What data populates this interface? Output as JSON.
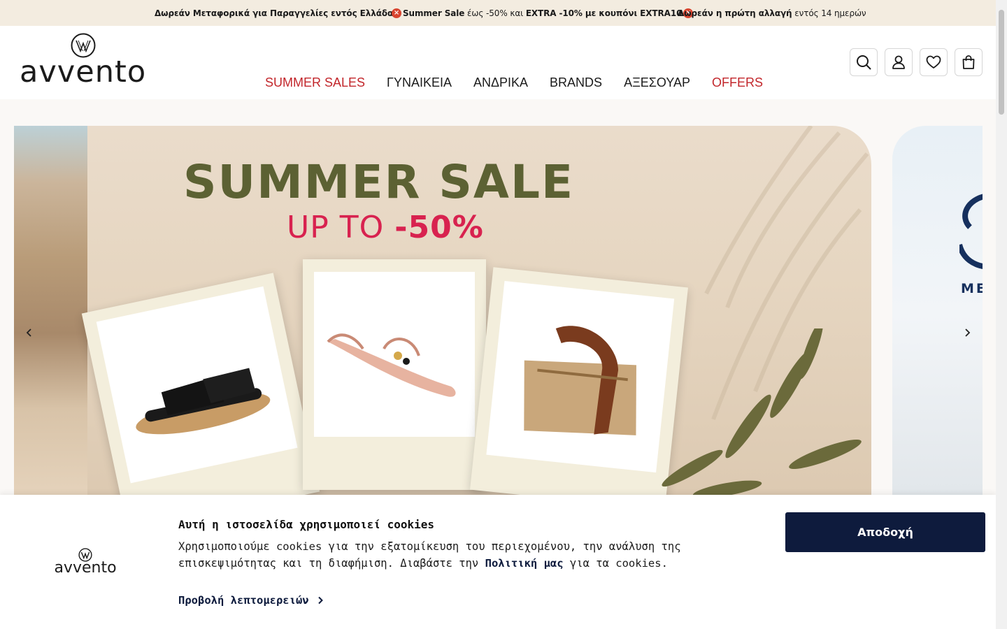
{
  "promo": {
    "item1": "Δωρεάν Μεταφορικά για Παραγγελίες εντός Ελλάδας",
    "item2_bold1": "Summer Sale",
    "item2_mid": " έως -50% και ",
    "item2_bold2": "EXTRA -10% με κουπόνι EXTRA10",
    "item3_bold": "Δωρεάν η πρώτη αλλαγή",
    "item3_rest": " εντός 14 ημερών",
    "badge_glyph": "×"
  },
  "header": {
    "logo_text": "avvento",
    "nav": [
      {
        "label": "SUMMER SALES",
        "highlight": true
      },
      {
        "label": "ΓΥΝΑΙΚΕΙΑ",
        "highlight": false
      },
      {
        "label": "ΑΝΔΡΙΚΑ",
        "highlight": false
      },
      {
        "label": "BRANDS",
        "highlight": false
      },
      {
        "label": "ΑΞΕΣΟΥΑΡ",
        "highlight": false
      },
      {
        "label": "OFFERS",
        "highlight": true
      }
    ],
    "icons": [
      "search-icon",
      "user-icon",
      "heart-icon",
      "bag-icon"
    ]
  },
  "hero": {
    "title": "SUMMER SALE",
    "sub_prefix": "UP TO ",
    "sub_value": "-50%",
    "next_slide_text": "ME"
  },
  "cookie": {
    "logo_text": "avvento",
    "title": "Αυτή η ιστοσελίδα χρησιμοποιεί cookies",
    "text_before": "Χρησιμοποιούμε cookies για την εξατομίκευση του περιεχομένου, την ανάλυση της επισκεψιμότητας και τη διαφήμιση. Διαβάστε την ",
    "link": "Πολιτική μας",
    "text_after": " για τα cookies.",
    "details": "Προβολή λεπτομερειών",
    "accept": "Αποδοχή"
  },
  "colors": {
    "accent_red": "#c2262b",
    "navy": "#0e1b3d",
    "promo_bg": "#f3ece0",
    "sale_olive": "#5c6133",
    "sale_pink": "#d8224f"
  }
}
